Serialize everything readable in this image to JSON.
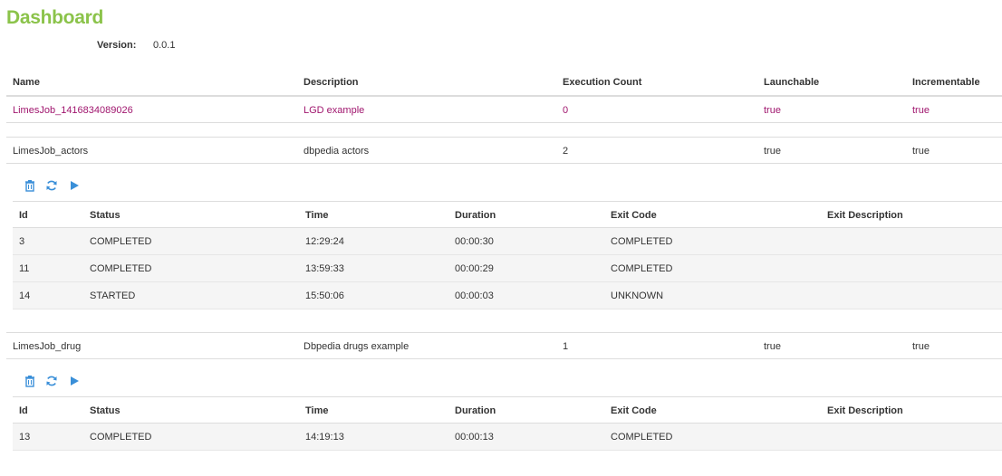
{
  "page": {
    "title": "Dashboard",
    "version_label": "Version:",
    "version_value": "0.0.1"
  },
  "columns": {
    "name": "Name",
    "description": "Description",
    "execution_count": "Execution Count",
    "launchable": "Launchable",
    "incrementable": "Incrementable"
  },
  "exec_columns": {
    "id": "Id",
    "status": "Status",
    "time": "Time",
    "duration": "Duration",
    "exit_code": "Exit Code",
    "exit_description": "Exit Description"
  },
  "icons": {
    "delete": "trash-icon",
    "refresh": "refresh-icon",
    "launch": "play-icon"
  },
  "colors": {
    "title": "#8bc34a",
    "highlight": "#a0166e",
    "icon": "#3a8fd8"
  },
  "jobs": [
    {
      "name": "LimesJob_1416834089026",
      "description": "LGD example",
      "count": "0",
      "launchable": "true",
      "incrementable": "true"
    },
    {
      "name": "LimesJob_actors",
      "description": "dbpedia actors",
      "count": "2",
      "launchable": "true",
      "incrementable": "true",
      "executions": [
        {
          "id": "3",
          "status": "COMPLETED",
          "time": "12:29:24",
          "duration": "00:00:30",
          "exit_code": "COMPLETED",
          "exit_description": ""
        },
        {
          "id": "11",
          "status": "COMPLETED",
          "time": "13:59:33",
          "duration": "00:00:29",
          "exit_code": "COMPLETED",
          "exit_description": ""
        },
        {
          "id": "14",
          "status": "STARTED",
          "time": "15:50:06",
          "duration": "00:00:03",
          "exit_code": "UNKNOWN",
          "exit_description": ""
        }
      ]
    },
    {
      "name": "LimesJob_drug",
      "description": "Dbpedia drugs example",
      "count": "1",
      "launchable": "true",
      "incrementable": "true",
      "executions": [
        {
          "id": "13",
          "status": "COMPLETED",
          "time": "14:19:13",
          "duration": "00:00:13",
          "exit_code": "COMPLETED",
          "exit_description": ""
        }
      ]
    }
  ]
}
